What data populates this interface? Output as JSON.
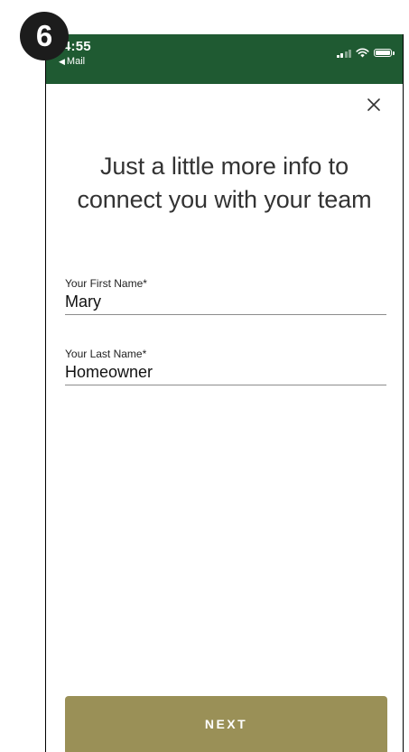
{
  "step_badge": "6",
  "status_bar": {
    "time": "4:55",
    "back_label": "Mail",
    "back_icon": "back-arrow-icon",
    "signal_icon": "cellular-signal-icon",
    "wifi_icon": "wifi-icon",
    "battery_icon": "battery-icon",
    "background_color": "#1f5a32"
  },
  "close_icon": "close-icon",
  "heading": "Just a little more info to connect you with your team",
  "form": {
    "first_name": {
      "label": "Your First Name*",
      "value": "Mary"
    },
    "last_name": {
      "label": "Your Last Name*",
      "value": "Homeowner"
    }
  },
  "next_button": {
    "label": "NEXT",
    "color": "#9a9057"
  }
}
